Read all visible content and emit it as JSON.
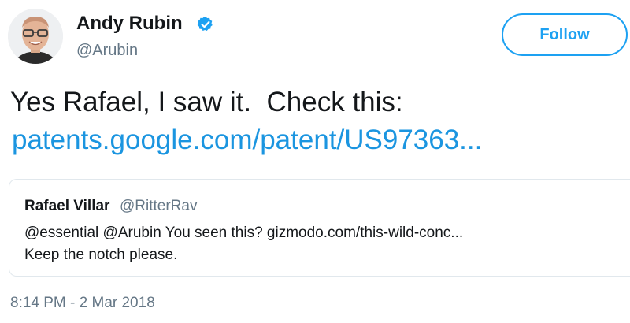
{
  "author": {
    "name": "Andy Rubin",
    "handle": "@Arubin",
    "avatar": "profile-photo",
    "verified_icon": "verified-badge-icon"
  },
  "follow_button": {
    "label": "Follow"
  },
  "tweet": {
    "text": "Yes Rafael, I saw it.  Check this:",
    "link_text": "patents.google.com/patent/US97363..."
  },
  "quoted_tweet": {
    "name": "Rafael Villar",
    "handle": "@RitterRav",
    "line1": "@essential @Arubin You seen this? gizmodo.com/this-wild-conc...",
    "line2": "Keep the notch please."
  },
  "timestamp": "8:14 PM - 2 Mar 2018",
  "colors": {
    "accent": "#1da1f2",
    "link": "#1b95e0",
    "text_primary": "#14171a",
    "text_secondary": "#657786",
    "border": "#e1e8ed"
  }
}
